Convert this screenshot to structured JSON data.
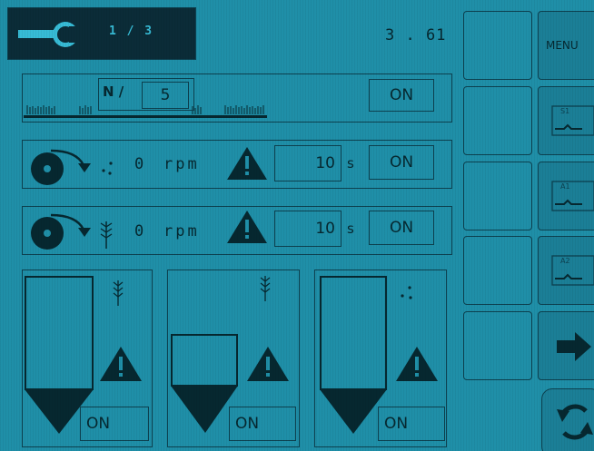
{
  "header": {
    "page_indicator": "1 / 3",
    "version": "3 . 61"
  },
  "seed_row": {
    "prefix": "N /",
    "count": "5",
    "toggle": "ON"
  },
  "fan_rows": [
    {
      "value": "0",
      "unit": "rpm",
      "time": "10",
      "time_unit": "s",
      "toggle": "ON"
    },
    {
      "value": "0",
      "unit": "rpm",
      "time": "10",
      "time_unit": "s",
      "toggle": "ON"
    }
  ],
  "hoppers": [
    {
      "toggle": "ON"
    },
    {
      "toggle": "ON"
    },
    {
      "toggle": "ON"
    }
  ],
  "side": {
    "menu_label": "MENU",
    "chart_labels": [
      "S1",
      "A1",
      "A2"
    ]
  }
}
